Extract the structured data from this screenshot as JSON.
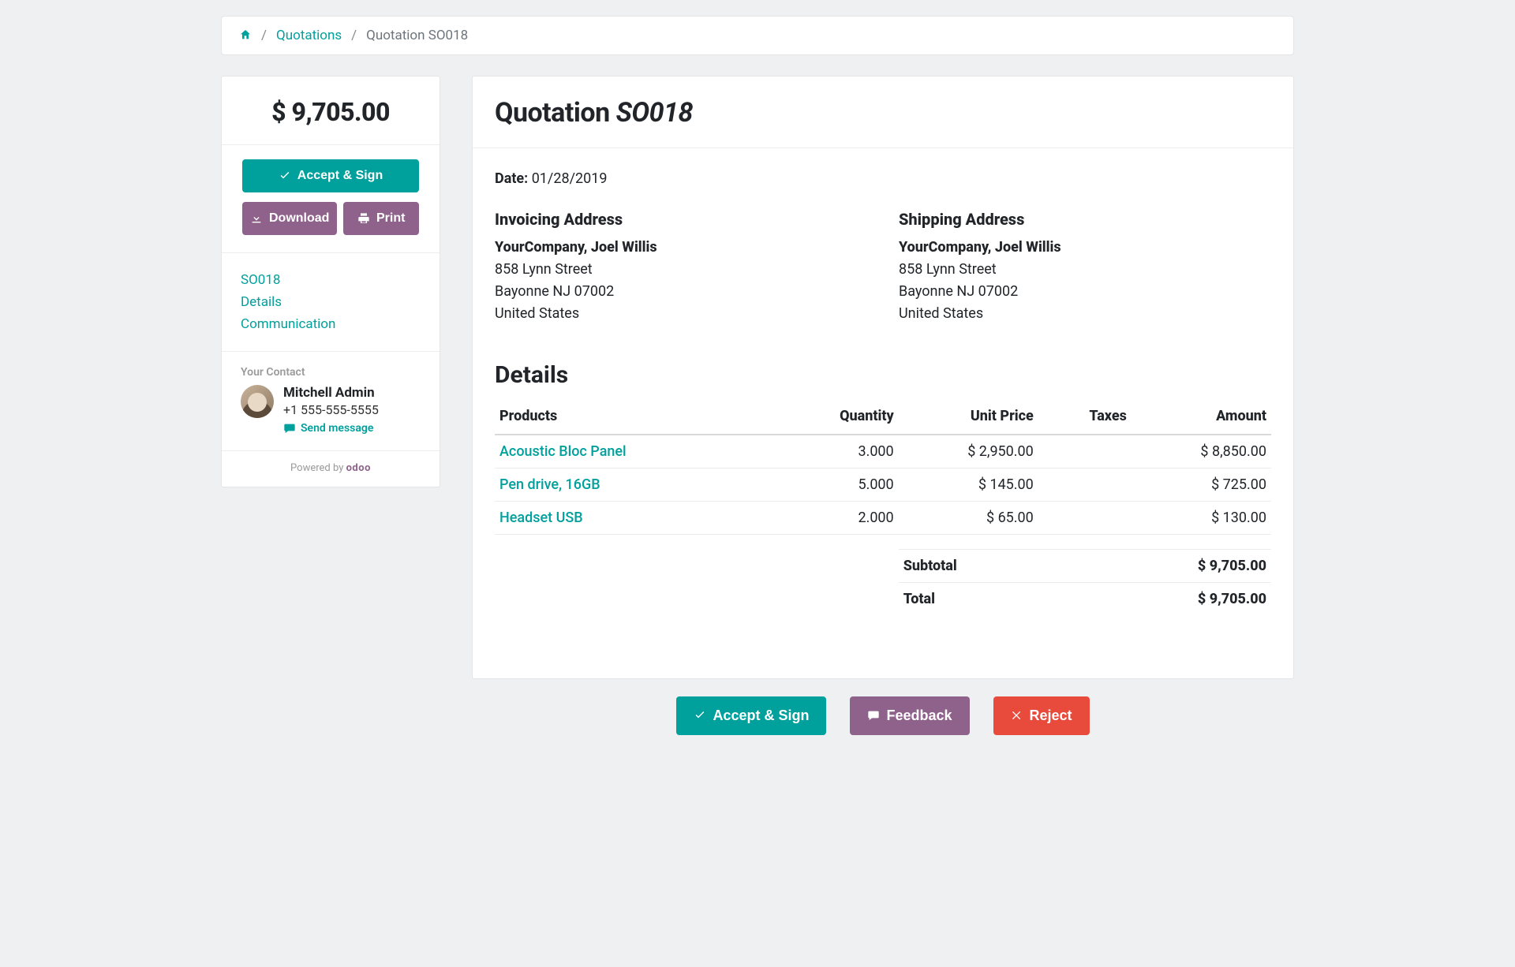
{
  "breadcrumb": {
    "home_title": "Home",
    "quotations": "Quotations",
    "current": "Quotation SO018"
  },
  "sidebar": {
    "total": "$ 9,705.00",
    "accept_sign": "Accept & Sign",
    "download": "Download",
    "print": "Print",
    "nav": {
      "so": "SO018",
      "details": "Details",
      "communication": "Communication"
    },
    "contact_label": "Your Contact",
    "contact_name": "Mitchell Admin",
    "contact_phone": "+1 555-555-5555",
    "send_message": "Send message",
    "powered_by": "Powered by",
    "brand": "odoo"
  },
  "quotation": {
    "title_prefix": "Quotation ",
    "number": "SO018",
    "date_label": "Date:",
    "date": "01/28/2019",
    "invoicing_title": "Invoicing Address",
    "shipping_title": "Shipping Address",
    "invoicing": {
      "name": "YourCompany, Joel Willis",
      "line1": "858 Lynn Street",
      "line2": "Bayonne NJ 07002",
      "country": "United States"
    },
    "shipping": {
      "name": "YourCompany, Joel Willis",
      "line1": "858 Lynn Street",
      "line2": "Bayonne NJ 07002",
      "country": "United States"
    }
  },
  "details": {
    "title": "Details",
    "headers": {
      "products": "Products",
      "quantity": "Quantity",
      "unit_price": "Unit Price",
      "taxes": "Taxes",
      "amount": "Amount"
    },
    "rows": [
      {
        "product": "Acoustic Bloc Panel",
        "qty": "3.000",
        "unit": "$ 2,950.00",
        "taxes": "",
        "amount": "$ 8,850.00"
      },
      {
        "product": "Pen drive, 16GB",
        "qty": "5.000",
        "unit": "$ 145.00",
        "taxes": "",
        "amount": "$ 725.00"
      },
      {
        "product": "Headset USB",
        "qty": "2.000",
        "unit": "$ 65.00",
        "taxes": "",
        "amount": "$ 130.00"
      }
    ],
    "subtotal_label": "Subtotal",
    "subtotal": "$ 9,705.00",
    "total_label": "Total",
    "total": "$ 9,705.00"
  },
  "footer": {
    "accept_sign": "Accept & Sign",
    "feedback": "Feedback",
    "reject": "Reject"
  }
}
